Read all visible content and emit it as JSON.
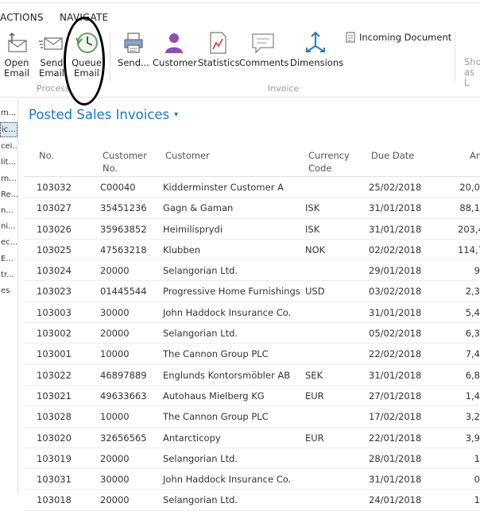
{
  "tabs": [
    "ACTIONS",
    "NAVIGATE"
  ],
  "ribbon": {
    "process_buttons": [
      {
        "label1": "Open",
        "label2": "Email",
        "icon": "open-email-icon"
      },
      {
        "label1": "Send",
        "label2": "Email",
        "icon": "send-email-icon"
      },
      {
        "label1": "Queue",
        "label2": "Email",
        "icon": "queue-email-icon"
      }
    ],
    "process_group": "Process",
    "invoice_buttons": [
      {
        "label1": "Send...",
        "icon": "print-send-icon"
      },
      {
        "label1": "Customer",
        "icon": "customer-icon"
      },
      {
        "label1": "Statistics",
        "icon": "statistics-icon"
      },
      {
        "label1": "Comments",
        "icon": "comments-icon"
      },
      {
        "label1": "Dimensions",
        "icon": "dimensions-icon"
      }
    ],
    "invoice_group": "Invoice",
    "incoming_document": "Incoming Document",
    "show_as_1": "Sho",
    "show_as_2": "as L"
  },
  "leftnav": [
    "m...",
    "ic...",
    "cei...",
    "lit...",
    "rn...",
    "Re...",
    "n...",
    "ni...",
    "ec...",
    "E...",
    "tr...",
    "es"
  ],
  "page_title": "Posted Sales Invoices",
  "columns": {
    "no": "No.",
    "customer_no_1": "Customer",
    "customer_no_2": "No.",
    "customer": "Customer",
    "currency_1": "Currency",
    "currency_2": "Code",
    "due_date": "Due Date",
    "amount": "An"
  },
  "rows": [
    {
      "no": "103032",
      "cno": "C00040",
      "cust": "Kidderminster Customer A",
      "cur": "",
      "due": "25/02/2018",
      "amt": "20,0"
    },
    {
      "no": "103027",
      "cno": "35451236",
      "cust": "Gagn & Gaman",
      "cur": "ISK",
      "due": "31/01/2018",
      "amt": "88,1"
    },
    {
      "no": "103026",
      "cno": "35963852",
      "cust": "Heimilisprydi",
      "cur": "ISK",
      "due": "31/01/2018",
      "amt": "203,4"
    },
    {
      "no": "103025",
      "cno": "47563218",
      "cust": "Klubben",
      "cur": "NOK",
      "due": "02/02/2018",
      "amt": "114,7"
    },
    {
      "no": "103024",
      "cno": "20000",
      "cust": "Selangorian Ltd.",
      "cur": "",
      "due": "29/01/2018",
      "amt": "9"
    },
    {
      "no": "103023",
      "cno": "01445544",
      "cust": "Progressive Home Furnishings",
      "cur": "USD",
      "due": "03/02/2018",
      "amt": "2,3"
    },
    {
      "no": "103003",
      "cno": "30000",
      "cust": "John Haddock Insurance Co.",
      "cur": "",
      "due": "31/01/2018",
      "amt": "5,4"
    },
    {
      "no": "103002",
      "cno": "20000",
      "cust": "Selangorian Ltd.",
      "cur": "",
      "due": "05/02/2018",
      "amt": "6,3"
    },
    {
      "no": "103001",
      "cno": "10000",
      "cust": "The Cannon Group PLC",
      "cur": "",
      "due": "22/02/2018",
      "amt": "7,4"
    },
    {
      "no": "103022",
      "cno": "46897889",
      "cust": "Englunds Kontorsmöbler AB",
      "cur": "SEK",
      "due": "31/01/2018",
      "amt": "6,8"
    },
    {
      "no": "103021",
      "cno": "49633663",
      "cust": "Autohaus Mielberg KG",
      "cur": "EUR",
      "due": "27/01/2018",
      "amt": "1,4"
    },
    {
      "no": "103028",
      "cno": "10000",
      "cust": "The Cannon Group PLC",
      "cur": "",
      "due": "17/02/2018",
      "amt": "3,2"
    },
    {
      "no": "103020",
      "cno": "32656565",
      "cust": "Antarcticopy",
      "cur": "EUR",
      "due": "22/01/2018",
      "amt": "3,9"
    },
    {
      "no": "103019",
      "cno": "20000",
      "cust": "Selangorian Ltd.",
      "cur": "",
      "due": "28/01/2018",
      "amt": "1"
    },
    {
      "no": "103031",
      "cno": "30000",
      "cust": "John Haddock Insurance Co.",
      "cur": "",
      "due": "31/01/2018",
      "amt": "0"
    },
    {
      "no": "103018",
      "cno": "20000",
      "cust": "Selangorian Ltd.",
      "cur": "",
      "due": "24/01/2018",
      "amt": "1"
    }
  ]
}
